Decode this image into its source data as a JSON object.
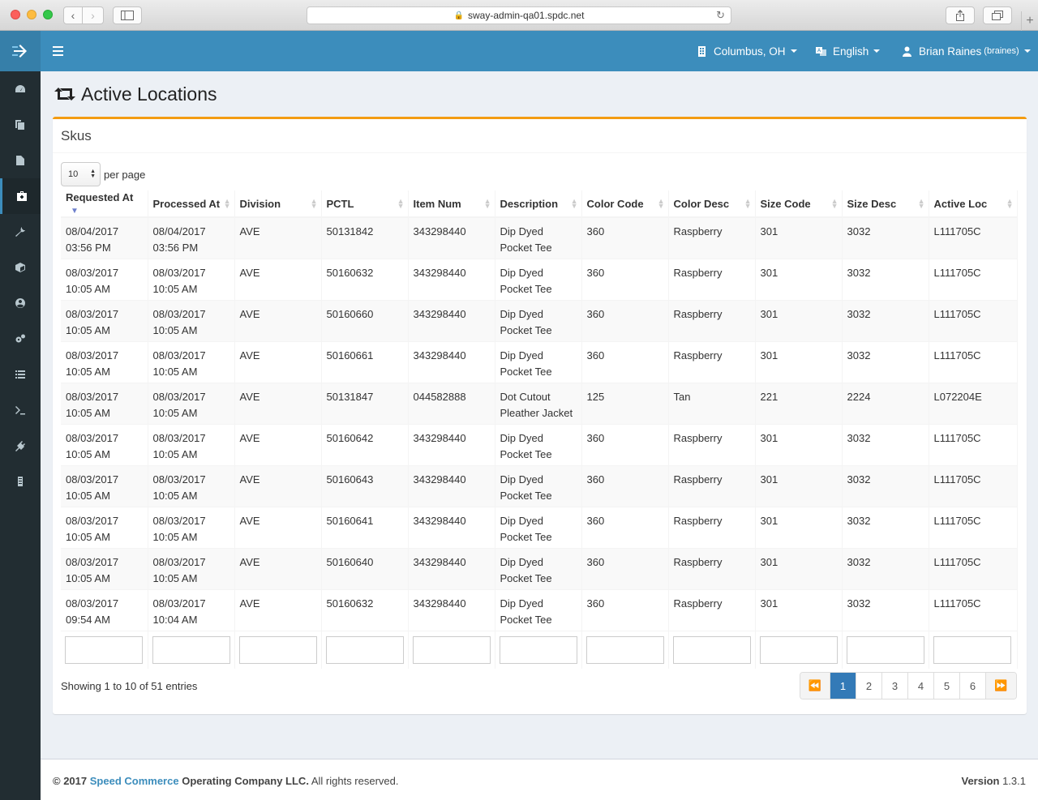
{
  "browser": {
    "url": "sway-admin-qa01.spdc.net"
  },
  "header": {
    "location": "Columbus, OH",
    "language": "English",
    "user_name": "Brian Raines",
    "user_login": "(braines)"
  },
  "page": {
    "title": "Active Locations"
  },
  "box": {
    "title": "Skus",
    "per_page_value": "10",
    "per_page_label": "per page",
    "columns": [
      "Requested At",
      "Processed At",
      "Division",
      "PCTL",
      "Item Num",
      "Description",
      "Color Code",
      "Color Desc",
      "Size Code",
      "Size Desc",
      "Active Loc"
    ],
    "rows": [
      [
        "08/04/2017 03:56 PM",
        "08/04/2017 03:56 PM",
        "AVE",
        "50131842",
        "343298440",
        "Dip Dyed Pocket Tee",
        "360",
        "Raspberry",
        "301",
        "3032",
        "L111705C"
      ],
      [
        "08/03/2017 10:05 AM",
        "08/03/2017 10:05 AM",
        "AVE",
        "50160632",
        "343298440",
        "Dip Dyed Pocket Tee",
        "360",
        "Raspberry",
        "301",
        "3032",
        "L111705C"
      ],
      [
        "08/03/2017 10:05 AM",
        "08/03/2017 10:05 AM",
        "AVE",
        "50160660",
        "343298440",
        "Dip Dyed Pocket Tee",
        "360",
        "Raspberry",
        "301",
        "3032",
        "L111705C"
      ],
      [
        "08/03/2017 10:05 AM",
        "08/03/2017 10:05 AM",
        "AVE",
        "50160661",
        "343298440",
        "Dip Dyed Pocket Tee",
        "360",
        "Raspberry",
        "301",
        "3032",
        "L111705C"
      ],
      [
        "08/03/2017 10:05 AM",
        "08/03/2017 10:05 AM",
        "AVE",
        "50131847",
        "044582888",
        "Dot Cutout Pleather Jacket",
        "125",
        "Tan",
        "221",
        "2224",
        "L072204E"
      ],
      [
        "08/03/2017 10:05 AM",
        "08/03/2017 10:05 AM",
        "AVE",
        "50160642",
        "343298440",
        "Dip Dyed Pocket Tee",
        "360",
        "Raspberry",
        "301",
        "3032",
        "L111705C"
      ],
      [
        "08/03/2017 10:05 AM",
        "08/03/2017 10:05 AM",
        "AVE",
        "50160643",
        "343298440",
        "Dip Dyed Pocket Tee",
        "360",
        "Raspberry",
        "301",
        "3032",
        "L111705C"
      ],
      [
        "08/03/2017 10:05 AM",
        "08/03/2017 10:05 AM",
        "AVE",
        "50160641",
        "343298440",
        "Dip Dyed Pocket Tee",
        "360",
        "Raspberry",
        "301",
        "3032",
        "L111705C"
      ],
      [
        "08/03/2017 10:05 AM",
        "08/03/2017 10:05 AM",
        "AVE",
        "50160640",
        "343298440",
        "Dip Dyed Pocket Tee",
        "360",
        "Raspberry",
        "301",
        "3032",
        "L111705C"
      ],
      [
        "08/03/2017 09:54 AM",
        "08/03/2017 10:04 AM",
        "AVE",
        "50160632",
        "343298440",
        "Dip Dyed Pocket Tee",
        "360",
        "Raspberry",
        "301",
        "3032",
        "L111705C"
      ]
    ],
    "showing": "Showing 1 to 10 of 51 entries",
    "pages": [
      "1",
      "2",
      "3",
      "4",
      "5",
      "6"
    ],
    "current_page": "1"
  },
  "footer": {
    "copyright_prefix": "© 2017",
    "company_link": "Speed Commerce",
    "copyright_company": "Operating Company LLC.",
    "rights": "All rights reserved.",
    "version_label": "Version",
    "version_value": "1.3.1"
  },
  "colors": {
    "header": "#3c8dbc",
    "sidebar": "#222d32",
    "box_accent": "#f39c12",
    "page_active": "#337ab7"
  },
  "icons": {
    "sidebar": [
      "dashboard-icon",
      "copy-icon",
      "file-icon",
      "medkit-icon",
      "wrench-icon",
      "cube-icon",
      "user-circle-icon",
      "cogs-icon",
      "list-icon",
      "terminal-icon",
      "plug-icon",
      "server-icon"
    ]
  }
}
